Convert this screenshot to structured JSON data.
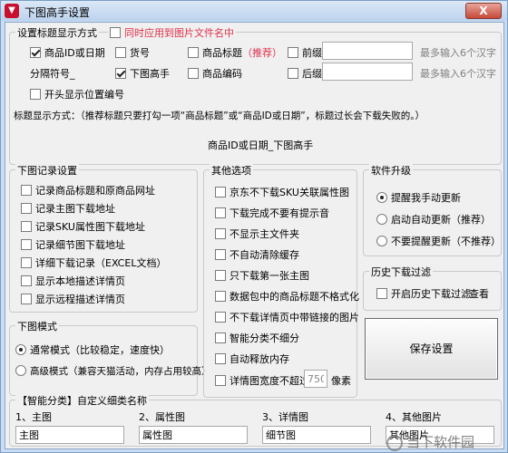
{
  "window": {
    "title": "下图高手设置",
    "close_label": "X",
    "app_icon_glyph": "▼"
  },
  "title_display": {
    "group_label": "设置标题显示方式",
    "apply_to_filename_label": "同时应用到图片文件名中",
    "checkboxes": {
      "product_id_date": "商品ID或日期",
      "sku_no": "货号",
      "product_title": "商品标题",
      "recommend": "（推荐）",
      "prefix": "前缀",
      "downloader": "下图高手",
      "product_code": "商品编码",
      "suffix": "后缀",
      "position_numbering": "开头显示位置编号"
    },
    "prefix_hint": "最多输入6个汉字",
    "suffix_hint": "最多输入6个汉字",
    "separator_label": "分隔符号_",
    "note": "标题显示方式：（推荐标题只要打勾一项“商品标题”或“商品ID或日期”，标题过长会下载失败的。）",
    "preview": "商品ID或日期_下图高手"
  },
  "download_log": {
    "group_label": "下图记录设置",
    "items": [
      "记录商品标题和原商品网址",
      "记录主图下载地址",
      "记录SKU属性图下载地址",
      "记录细节图下载地址",
      "详细下载记录（EXCEL文档）",
      "显示本地描述详情页",
      "显示远程描述详情页"
    ]
  },
  "mode": {
    "group_label": "下图模式",
    "normal": "通常模式（比较稳定，速度快）",
    "advanced": "高级模式（兼容天猫活动，内存占用较高）"
  },
  "other": {
    "group_label": "其他选项",
    "items": [
      "京东不下载SKU关联属性图",
      "下载完成不要有提示音",
      "不显示主文件夹",
      "不自动清除缓存",
      "只下载第一张主图",
      "数据包中的商品标题不格式化",
      "不下载详情页中带链接的图片",
      "智能分类不细分",
      "自动释放内存"
    ],
    "width_label": "详情图宽度不超过:",
    "width_value": "750",
    "width_unit": "像素"
  },
  "upgrade": {
    "group_label": "软件升级",
    "options": [
      "提醒我手动更新",
      "启动自动更新（推荐）",
      "不要提醒更新（不推荐）"
    ]
  },
  "history": {
    "group_label": "历史下载过滤",
    "enable_label": "开启历史下载过滤",
    "view_label": "查看"
  },
  "save_label": "保存设置",
  "smart_category": {
    "group_label": "【智能分类】自定义细类名称",
    "fields": [
      {
        "label": "1、主图",
        "value": "主图"
      },
      {
        "label": "2、属性图",
        "value": "属性图"
      },
      {
        "label": "3、详情图",
        "value": "细节图"
      },
      {
        "label": "4、其他图片",
        "value": "其他图片"
      }
    ]
  },
  "watermark": "当下软件园"
}
